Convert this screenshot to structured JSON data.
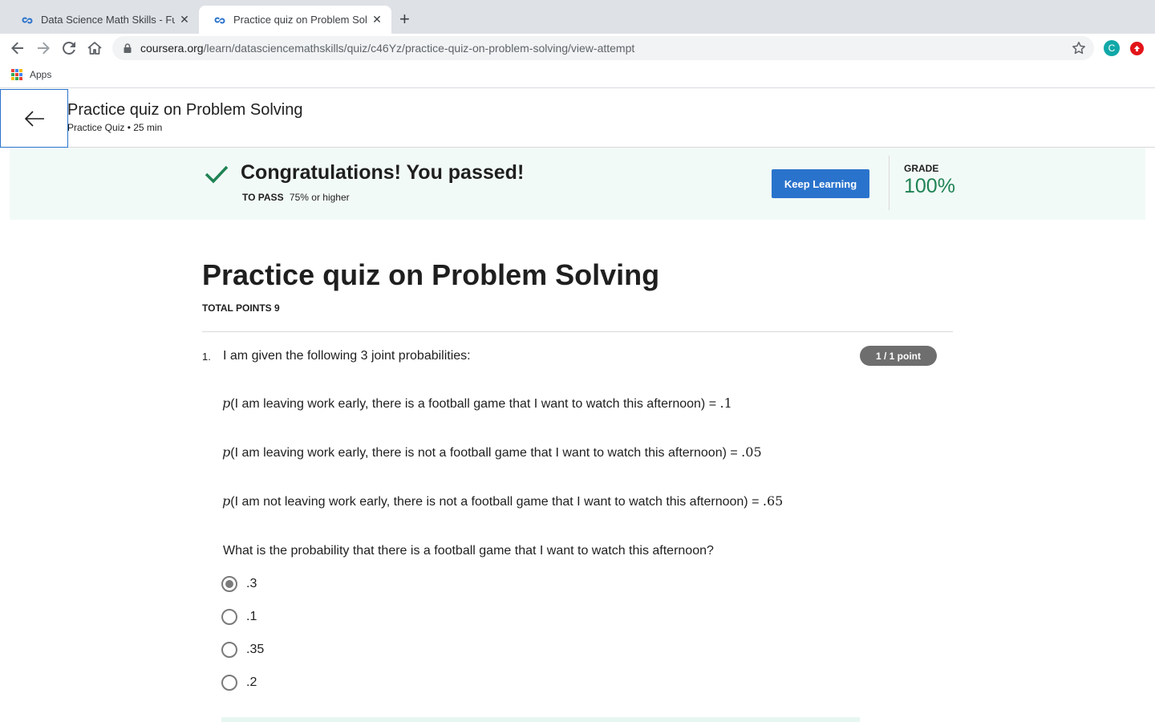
{
  "browser": {
    "tabs": [
      {
        "title": "Data Science Math Skills - Fund",
        "active": false
      },
      {
        "title": "Practice quiz on Problem Solving",
        "active": true
      }
    ],
    "url_domain": "coursera.org",
    "url_path": "/learn/datasciencemathskills/quiz/c46Yz/practice-quiz-on-problem-solving/view-attempt",
    "profile_initial": "C",
    "bookmarks": {
      "apps_label": "Apps"
    }
  },
  "header": {
    "title": "Practice quiz on Problem Solving",
    "subtitle": "Practice Quiz • 25 min"
  },
  "banner": {
    "message": "Congratulations! You passed!",
    "to_pass_label": "TO PASS",
    "to_pass_value": "75% or higher",
    "keep_learning_label": "Keep Learning",
    "grade_label": "GRADE",
    "grade_value": "100%"
  },
  "quiz": {
    "title": "Practice quiz on Problem Solving",
    "total_points": "TOTAL POINTS 9",
    "question": {
      "number": "1.",
      "intro": "I am given the following 3 joint probabilities:",
      "points_badge": "1 / 1 point",
      "probabilities": [
        {
          "p": "p",
          "text": "(I am leaving work early, there is a football game that I want to watch this afternoon) = ",
          "value": ".1"
        },
        {
          "p": "p",
          "text": "(I am leaving work early, there is not a football game that I want to watch this afternoon) = ",
          "value": ".05"
        },
        {
          "p": "p",
          "text": "(I am not leaving work early, there is not a football game that I want to watch this afternoon) = ",
          "value": ".65"
        }
      ],
      "prompt": "What is the probability that there is a football game that I want to watch this afternoon?",
      "options": [
        {
          "label": ".3",
          "selected": true
        },
        {
          "label": ".1",
          "selected": false
        },
        {
          "label": ".35",
          "selected": false
        },
        {
          "label": ".2",
          "selected": false
        }
      ]
    }
  },
  "colors": {
    "primary": "#2a73cc",
    "success": "#1f8354",
    "banner_bg": "#f2faf7"
  }
}
